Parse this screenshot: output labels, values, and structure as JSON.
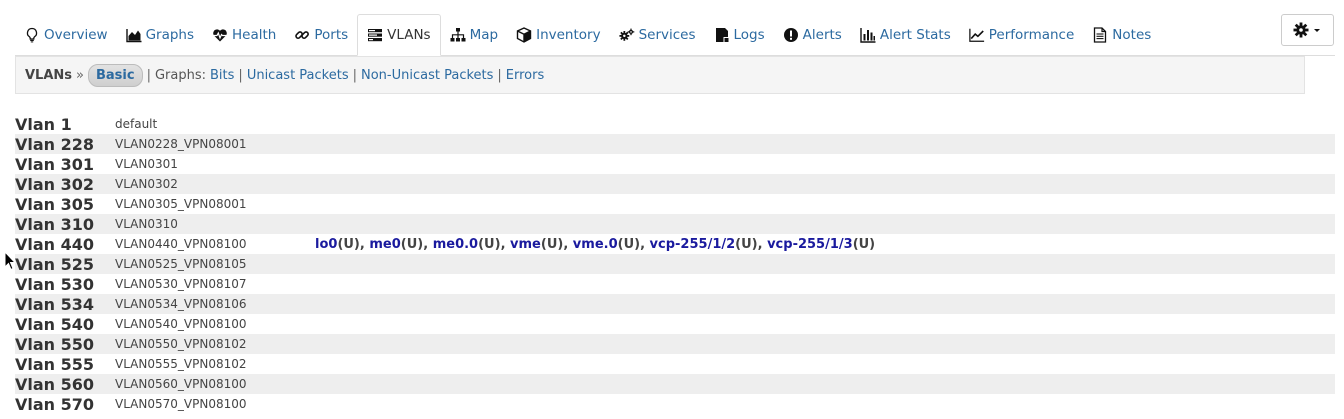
{
  "nav": {
    "tabs": [
      {
        "label": "Overview",
        "icon": "lightbulb-icon",
        "active": false
      },
      {
        "label": "Graphs",
        "icon": "area-chart-icon",
        "active": false
      },
      {
        "label": "Health",
        "icon": "heartbeat-icon",
        "active": false
      },
      {
        "label": "Ports",
        "icon": "link-icon",
        "active": false
      },
      {
        "label": "VLANs",
        "icon": "tasks-icon",
        "active": true
      },
      {
        "label": "Map",
        "icon": "sitemap-icon",
        "active": false
      },
      {
        "label": "Inventory",
        "icon": "cube-icon",
        "active": false
      },
      {
        "label": "Services",
        "icon": "cogs-icon",
        "active": false
      },
      {
        "label": "Logs",
        "icon": "log-file-icon",
        "active": false
      },
      {
        "label": "Alerts",
        "icon": "exclamation-circle-icon",
        "active": false
      },
      {
        "label": "Alert Stats",
        "icon": "bar-chart-icon",
        "active": false
      },
      {
        "label": "Performance",
        "icon": "line-chart-icon",
        "active": false
      },
      {
        "label": "Notes",
        "icon": "file-text-icon",
        "active": false
      }
    ],
    "settings_icon": "gear-icon"
  },
  "subnav": {
    "title": "VLANs",
    "arrow": "»",
    "active_view": "Basic",
    "graphs_label": "Graphs:",
    "graph_links": [
      "Bits",
      "Unicast Packets",
      "Non-Unicast Packets",
      "Errors"
    ]
  },
  "vlans": [
    {
      "id": "Vlan 1",
      "name": "default",
      "ports": []
    },
    {
      "id": "Vlan 228",
      "name": "VLAN0228_VPN08001",
      "ports": []
    },
    {
      "id": "Vlan 301",
      "name": "VLAN0301",
      "ports": []
    },
    {
      "id": "Vlan 302",
      "name": "VLAN0302",
      "ports": []
    },
    {
      "id": "Vlan 305",
      "name": "VLAN0305_VPN08001",
      "ports": []
    },
    {
      "id": "Vlan 310",
      "name": "VLAN0310",
      "ports": []
    },
    {
      "id": "Vlan 440",
      "name": "VLAN0440_VPN08100",
      "ports": [
        {
          "name": "lo0",
          "mode": "(U)"
        },
        {
          "name": "me0",
          "mode": "(U)"
        },
        {
          "name": "me0.0",
          "mode": "(U)"
        },
        {
          "name": "vme",
          "mode": "(U)"
        },
        {
          "name": "vme.0",
          "mode": "(U)"
        },
        {
          "name": "vcp-255/1/2",
          "mode": "(U)"
        },
        {
          "name": "vcp-255/1/3",
          "mode": "(U)"
        }
      ]
    },
    {
      "id": "Vlan 525",
      "name": "VLAN0525_VPN08105",
      "ports": []
    },
    {
      "id": "Vlan 530",
      "name": "VLAN0530_VPN08107",
      "ports": []
    },
    {
      "id": "Vlan 534",
      "name": "VLAN0534_VPN08106",
      "ports": []
    },
    {
      "id": "Vlan 540",
      "name": "VLAN0540_VPN08100",
      "ports": []
    },
    {
      "id": "Vlan 550",
      "name": "VLAN0550_VPN08102",
      "ports": []
    },
    {
      "id": "Vlan 555",
      "name": "VLAN0555_VPN08102",
      "ports": []
    },
    {
      "id": "Vlan 560",
      "name": "VLAN0560_VPN08100",
      "ports": []
    },
    {
      "id": "Vlan 570",
      "name": "VLAN0570_VPN08100",
      "ports": []
    }
  ],
  "colors": {
    "link": "#2c6aa0",
    "port_link": "#1a1a9e",
    "row_alt": "#eeeeee"
  }
}
